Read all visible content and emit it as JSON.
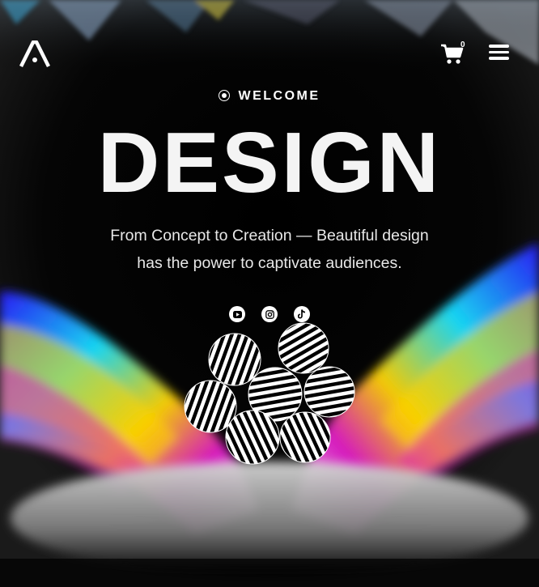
{
  "brand": {
    "logo_icon": "a-letter-logo-icon"
  },
  "header": {
    "cart_icon": "cart-icon",
    "cart_count": "0",
    "menu_icon": "hamburger-menu-icon"
  },
  "hero": {
    "eyebrow": "WELCOME",
    "title": "DESIGN",
    "subtitle_line1": "From Concept to Creation — Beautiful design",
    "subtitle_line2": "has the power to captivate audiences."
  },
  "socials": [
    {
      "icon": "youtube-icon"
    },
    {
      "icon": "instagram-icon"
    },
    {
      "icon": "tiktok-icon"
    }
  ],
  "colors": {
    "background": "#000000",
    "text": "#ffffff",
    "accent_cyan": "#18e0ff",
    "accent_magenta": "#e018c8",
    "accent_yellow": "#ffd500"
  }
}
